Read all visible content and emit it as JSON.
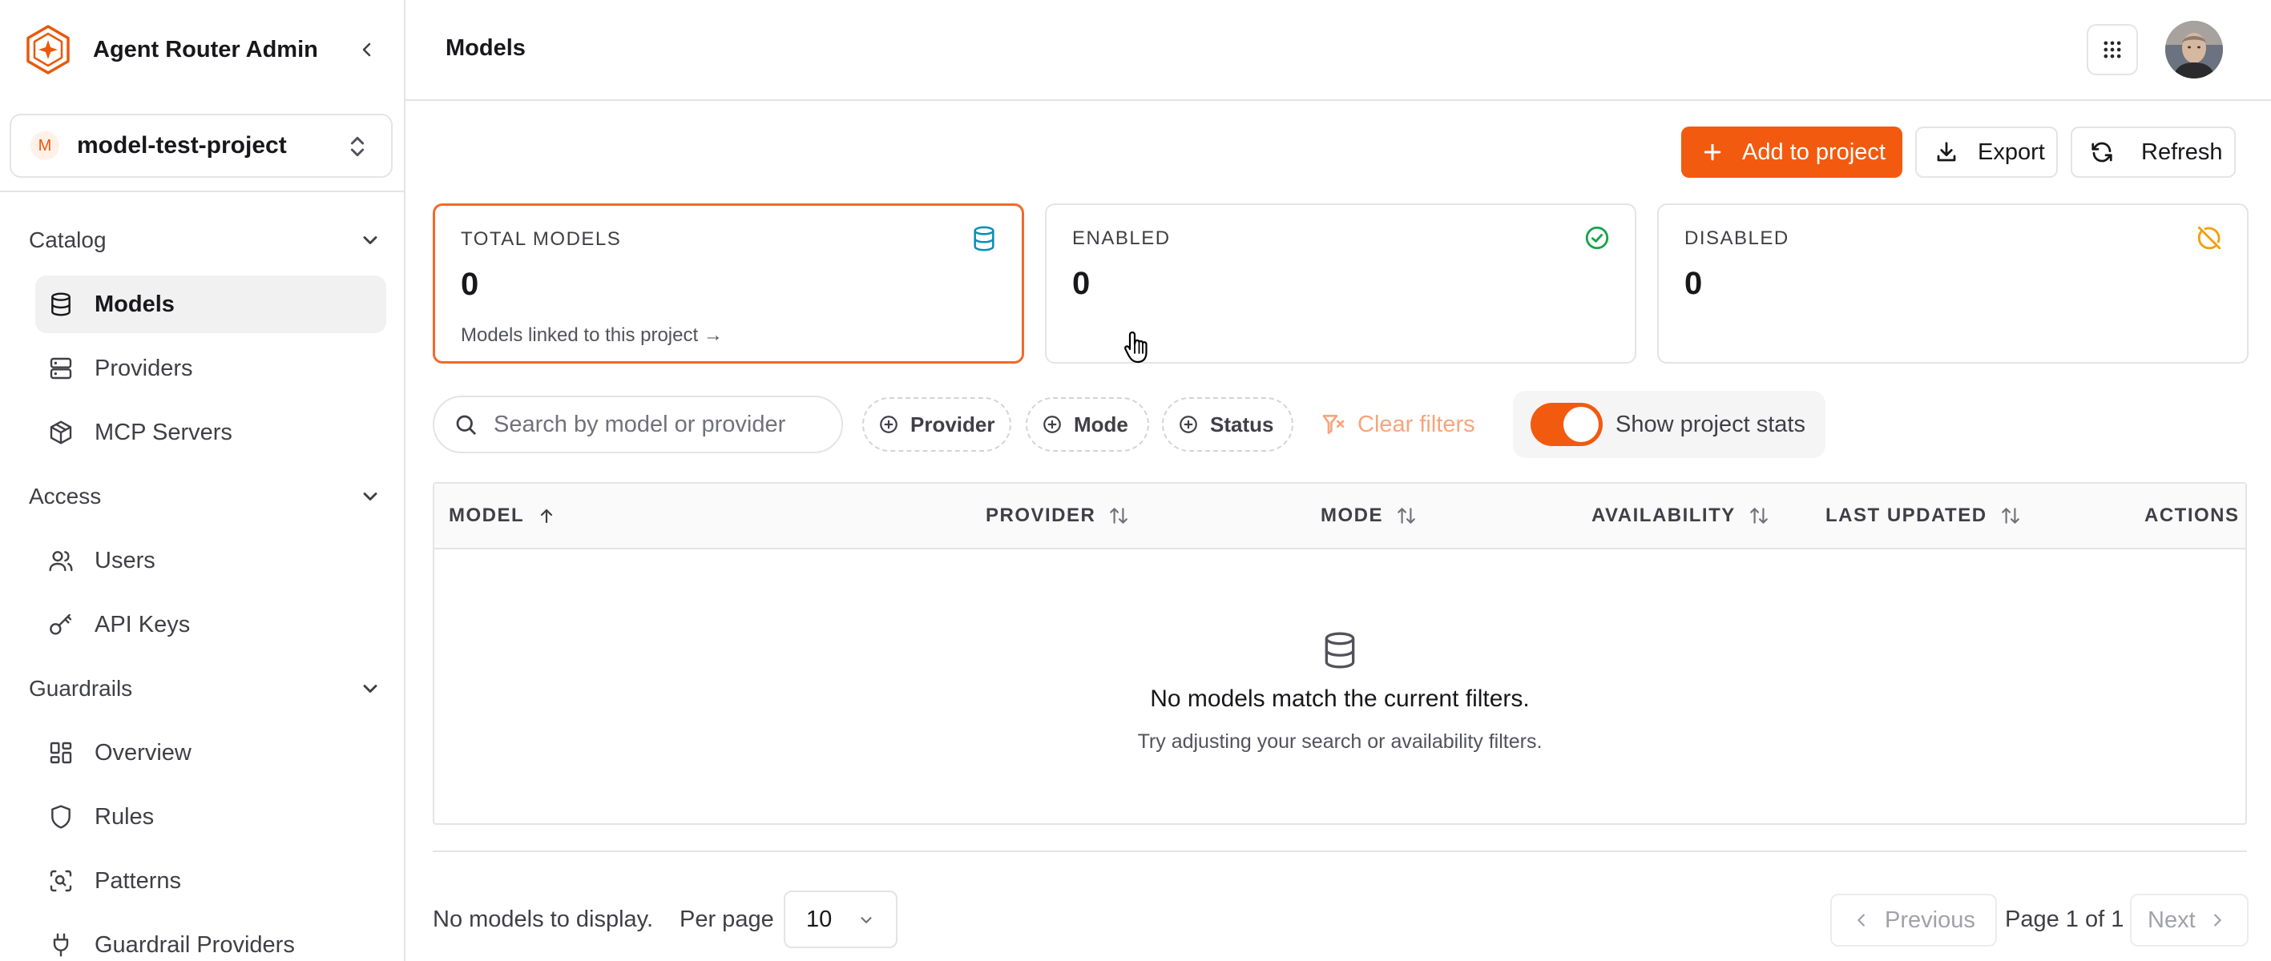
{
  "app": {
    "title": "Agent Router Admin"
  },
  "project": {
    "initial": "M",
    "name": "model-test-project"
  },
  "sidebar": {
    "groups": [
      {
        "label": "Catalog",
        "items": [
          {
            "label": "Models",
            "icon": "database-icon",
            "active": true
          },
          {
            "label": "Providers",
            "icon": "server-icon"
          },
          {
            "label": "MCP Servers",
            "icon": "package-icon"
          }
        ]
      },
      {
        "label": "Access",
        "items": [
          {
            "label": "Users",
            "icon": "users-icon"
          },
          {
            "label": "API Keys",
            "icon": "key-icon"
          }
        ]
      },
      {
        "label": "Guardrails",
        "items": [
          {
            "label": "Overview",
            "icon": "layout-dashboard-icon"
          },
          {
            "label": "Rules",
            "icon": "shield-icon"
          },
          {
            "label": "Patterns",
            "icon": "scan-search-icon"
          },
          {
            "label": "Guardrail Providers",
            "icon": "plug-icon"
          }
        ]
      }
    ]
  },
  "header": {
    "title": "Models"
  },
  "toolbar": {
    "add_label": "Add to project",
    "export_label": "Export",
    "refresh_label": "Refresh"
  },
  "stats": [
    {
      "label": "TOTAL MODELS",
      "value": "0",
      "link": "Models linked to this project →",
      "icon": "database-icon",
      "color": "#0891b2"
    },
    {
      "label": "ENABLED",
      "value": "0",
      "icon": "check-circle-icon",
      "color": "#16a34a"
    },
    {
      "label": "DISABLED",
      "value": "0",
      "icon": "circle-off-icon",
      "color": "#f59e0b"
    }
  ],
  "filters": {
    "search_placeholder": "Search by model or provider",
    "chips": [
      "Provider",
      "Mode",
      "Status"
    ],
    "clear_label": "Clear filters",
    "stats_toggle_label": "Show project stats",
    "stats_toggle_on": true
  },
  "table": {
    "columns": [
      "MODEL",
      "PROVIDER",
      "MODE",
      "AVAILABILITY",
      "LAST UPDATED",
      "ACTIONS"
    ],
    "empty_title": "No models match the current filters.",
    "empty_subtitle": "Try adjusting your search or availability filters."
  },
  "pagination": {
    "summary": "No models to display.",
    "per_page_label": "Per page",
    "per_page_value": "10",
    "previous_label": "Previous",
    "page_info": "Page 1 of 1",
    "next_label": "Next"
  },
  "colors": {
    "accent": "#f25a0f",
    "border": "#e4e4e7"
  }
}
